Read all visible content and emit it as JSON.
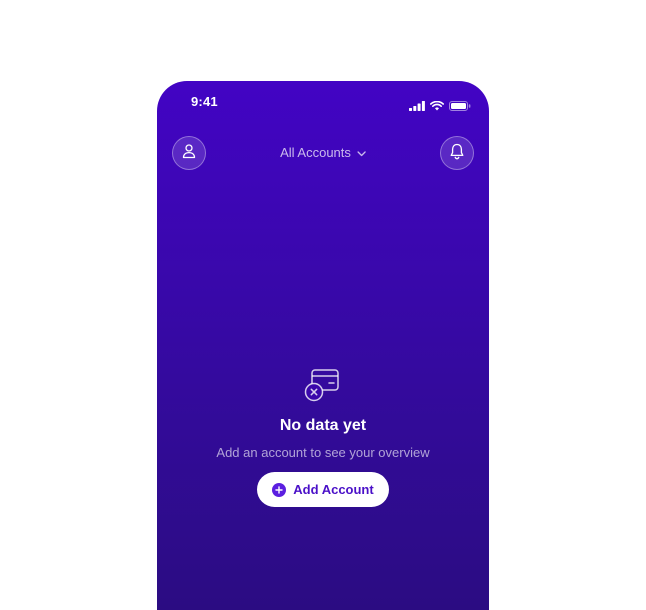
{
  "status_bar": {
    "time": "9:41"
  },
  "header": {
    "account_selector_label": "All Accounts",
    "left_icon": "user-icon",
    "right_icon": "bell-icon",
    "selector_icon": "chevron-down-icon"
  },
  "empty_state": {
    "icon": "wallet-remove-icon",
    "title": "No data yet",
    "subtitle": "Add an account to see your overview",
    "button_label": "Add Account",
    "button_icon": "plus-circle-icon"
  },
  "colors": {
    "gradient_top": "#4204c4",
    "gradient_bottom": "#2b0c82",
    "button_text": "#4a10c8",
    "button_background": "#ffffff"
  }
}
